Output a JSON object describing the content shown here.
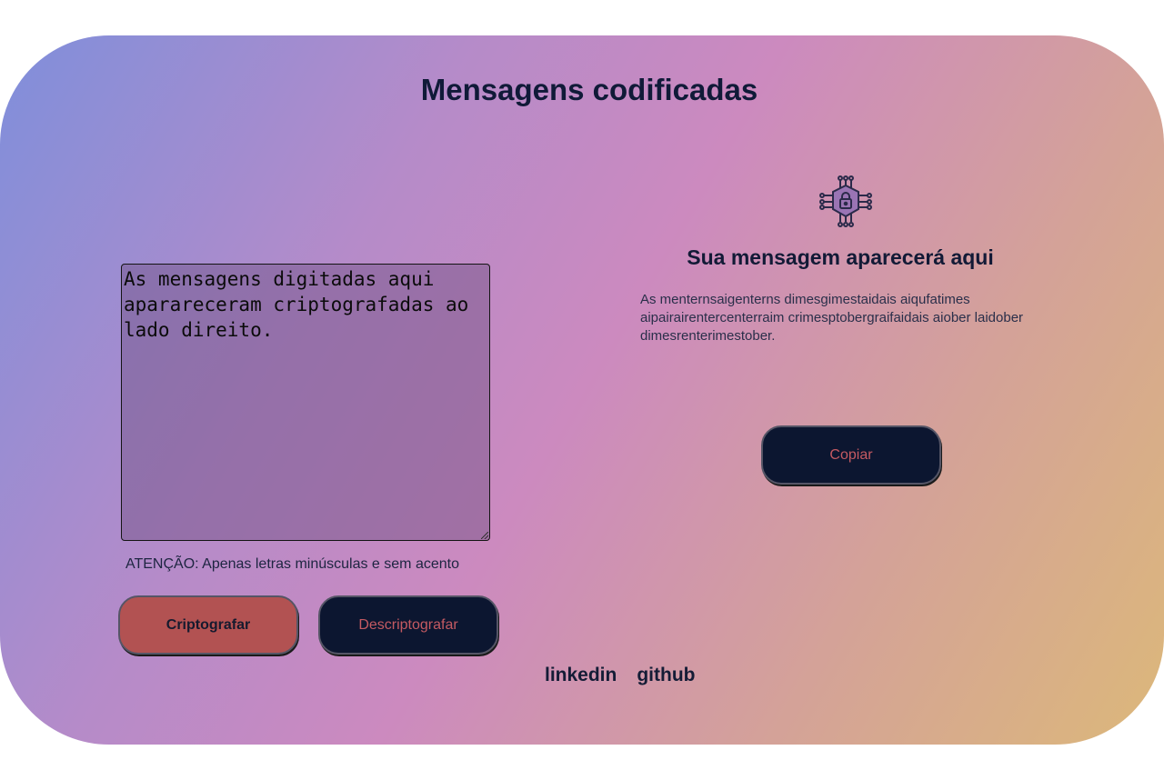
{
  "page": {
    "title": "Mensagens codificadas"
  },
  "input": {
    "text": "As mensagens digitadas aqui aparareceram criptografadas ao lado direito.",
    "warning": "ATENÇÃO: Apenas letras minúsculas e sem acento"
  },
  "buttons": {
    "encrypt_label": "Criptografar",
    "decrypt_label": "Descriptografar",
    "copy_label": "Copiar"
  },
  "output": {
    "icon": "security-lock-circuit-icon",
    "heading": "Sua mensagem aparecerá aqui",
    "text": "As menternsaigenterns dimesgimestaidais aiqufatimes aipairairentercenterraim crimesptobergraifaidais aiober laidober dimesrenterimestober."
  },
  "footer": {
    "links": [
      "linkedin",
      "github"
    ]
  },
  "colors": {
    "encrypt_button": "#b25252",
    "dark_button": "#0c1630",
    "accent_text": "#c45a62",
    "title_text": "#101a38"
  }
}
